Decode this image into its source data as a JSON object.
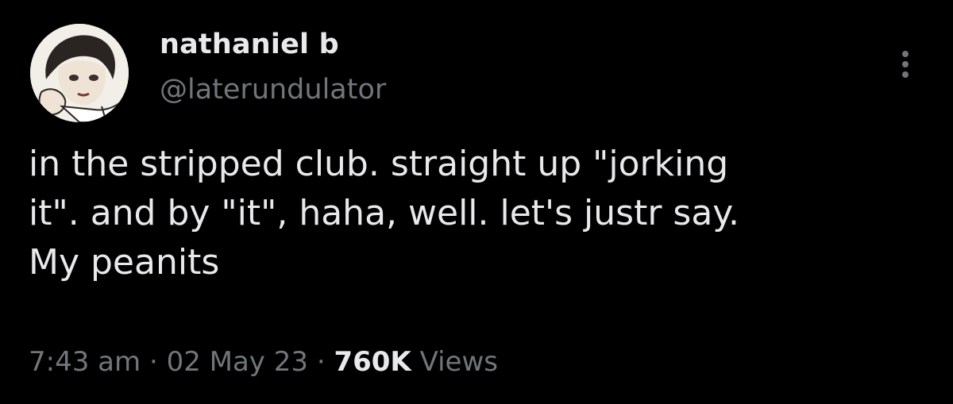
{
  "author": {
    "display_name": "nathaniel b",
    "handle": "@laterundulator",
    "avatar_icon": "profile-avatar"
  },
  "more_icon": "more-vertical-icon",
  "tweet": {
    "lines": [
      "in the stripped club. straight up \"jorking",
      "it\". and by \"it\", haha, well. let's justr say.",
      "My peanits"
    ]
  },
  "meta": {
    "time": "7:43 am",
    "separator": "·",
    "date": "02 May 23",
    "views_count": "760K",
    "views_label": "Views"
  },
  "colors": {
    "background": "#000000",
    "primary_text": "#e7e9ea",
    "secondary_text": "#71767b"
  }
}
